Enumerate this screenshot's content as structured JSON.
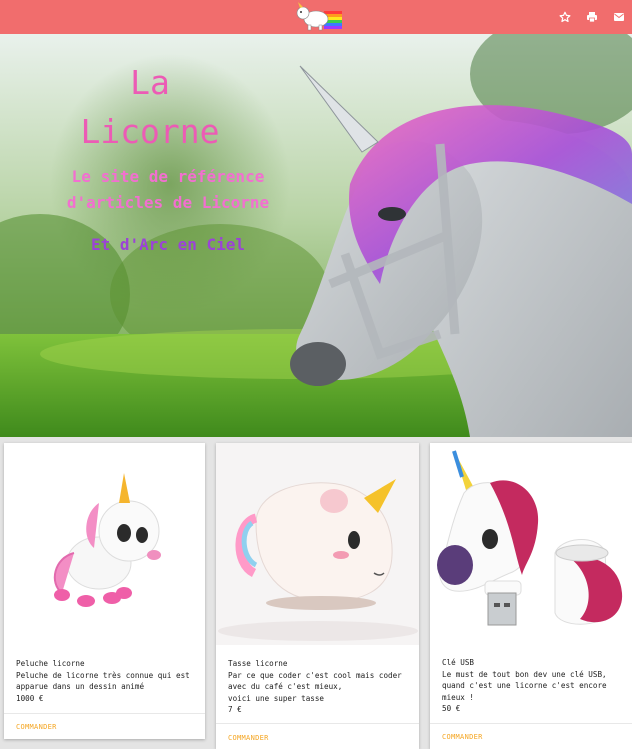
{
  "header": {
    "logo_icon": "rainbow-unicorn-logo-icon",
    "icons": [
      "star-icon",
      "print-icon",
      "mail-icon"
    ],
    "bar_color": "#f16d6d"
  },
  "hero": {
    "title_line1": "La",
    "title_line2": "Licorne",
    "subtitle_line1": "Le site de référence",
    "subtitle_line2": "d'articles de Licorne",
    "tagline": "Et d'Arc en Ciel"
  },
  "products": [
    {
      "name": "Peluche licorne",
      "description": "Peluche de licorne très connue qui est apparue dans un dessin animé",
      "price": "1000 €",
      "action": "COMMANDER"
    },
    {
      "name": "Tasse licorne",
      "description_line1": "Par ce que coder c'est cool mais coder avec du café c'est mieux,",
      "description_line2": "voici une super tasse",
      "price": "7 €",
      "action": "COMMANDER"
    },
    {
      "name": "Clé USB",
      "description": "Le must de tout bon dev une clé USB, quand c'est une licorne c'est encore mieux !",
      "price": "50 €",
      "action": "COMMANDER"
    }
  ]
}
